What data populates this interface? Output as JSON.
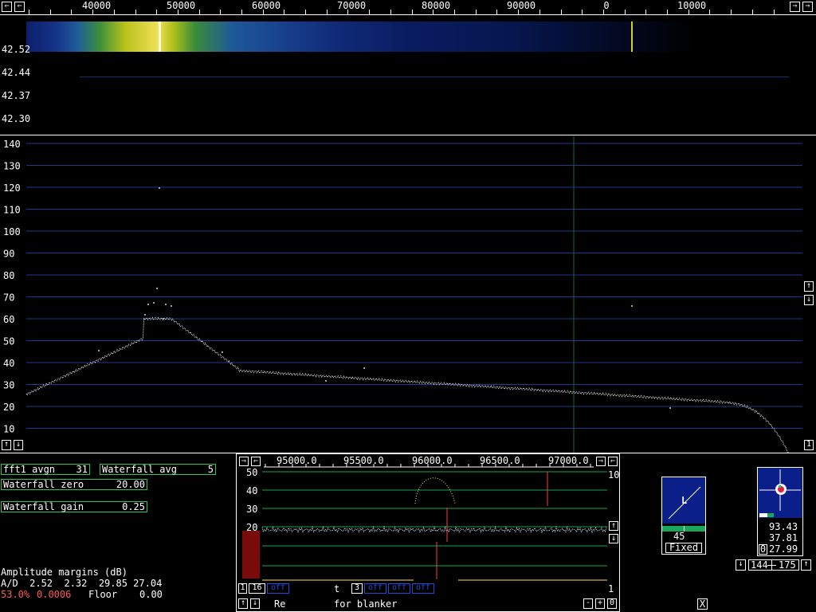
{
  "top_axis": {
    "labels": [
      "40000",
      "50000",
      "60000",
      "70000",
      "80000",
      "90000",
      "0",
      "10000"
    ],
    "left_arrow": "⇐",
    "right_arrow": "⇒",
    "right_arrow2": "⇐"
  },
  "waterfall": {
    "times": [
      "42.52",
      "42.44",
      "42.37",
      "42.30"
    ]
  },
  "spectrum": {
    "y_labels": [
      "140",
      "130",
      "120",
      "110",
      "100",
      "90",
      "80",
      "70",
      "60",
      "50",
      "40",
      "30",
      "20",
      "10"
    ],
    "marker_x_freq": 96900,
    "arrow_up": "↑",
    "arrow_down": "↓",
    "corner_one": "1"
  },
  "chart_data": [
    {
      "type": "scatter",
      "xlabel": "",
      "ylabel": "",
      "ylim": [
        0,
        145
      ],
      "xlim": [
        35000,
        15000
      ],
      "x_tick_labels": [
        "40000",
        "50000",
        "60000",
        "70000",
        "80000",
        "90000",
        "0",
        "10000"
      ],
      "y_tick_labels": [
        "140",
        "130",
        "120",
        "110",
        "100",
        "90",
        "80",
        "70",
        "60",
        "50",
        "40",
        "30",
        "20",
        "10"
      ],
      "series": [
        {
          "values_description_free": true,
          "points": [
            [
              35000,
              26
            ],
            [
              40000,
              32
            ],
            [
              43000,
              38
            ],
            [
              45000,
              55
            ],
            [
              46500,
              62
            ],
            [
              47500,
              60
            ],
            [
              49000,
              55
            ],
            [
              52000,
              40
            ],
            [
              56000,
              34
            ],
            [
              60000,
              30
            ],
            [
              65000,
              28
            ],
            [
              70000,
              26
            ],
            [
              75000,
              24
            ],
            [
              80000,
              22
            ],
            [
              85000,
              21
            ],
            [
              90000,
              20
            ],
            [
              95000,
              19
            ],
            [
              100000,
              18
            ],
            [
              104000,
              17
            ],
            [
              108000,
              14
            ],
            [
              112000,
              8
            ],
            [
              114000,
              0
            ]
          ]
        }
      ],
      "grid": true
    },
    {
      "type": "scatter",
      "title": "",
      "x_tick_labels": [
        "95000.0",
        "95500.0",
        "96000.0",
        "96500.0",
        "97000.0"
      ],
      "y_tick_labels": [
        "50",
        "40",
        "30",
        "20",
        "10",
        "0"
      ],
      "right_labels": [
        "10",
        "1"
      ],
      "grid": true
    }
  ],
  "controls": {
    "fft1_avgn_label": "fft1 avgn",
    "fft1_avgn_value": "31",
    "wf_avg_label": "Waterfall avg",
    "wf_avg_value": "5",
    "wf_zero_label": "Waterfall zero",
    "wf_zero_value": "20.00",
    "wf_gain_label": "Waterfall gain",
    "wf_gain_value": "0.25"
  },
  "amplitude": {
    "title": "Amplitude margins (dB)",
    "ad_line": "A/D  2.52  2.32  29.85 27.04",
    "pct": "53.0%",
    "val": "0.0006",
    "floor_label": "Floor",
    "floor_value": "0.00"
  },
  "bottom_panel": {
    "freq_labels": [
      "95000.0",
      "95500.0",
      "96000.0",
      "96500.0",
      "97000.0"
    ],
    "db_labels": [
      "50",
      "40",
      "30",
      "20",
      "10",
      "0"
    ],
    "right_top": "10",
    "right_bottom": "1",
    "row1": {
      "b1": "1",
      "b2": "16",
      "off1": "off",
      "t": "t",
      "three": "3",
      "off2": "off",
      "off3": "off",
      "off4": "off"
    },
    "row2": {
      "re": "Re",
      "for_blanker": "for blanker",
      "minus": "-",
      "plus": "+",
      "zero": "0"
    },
    "close": "X"
  },
  "meter_l": {
    "label": "L",
    "value": "45",
    "mode": "Fixed"
  },
  "meter_r": {
    "v1": "93.43",
    "v2": "37.81",
    "zero": "0",
    "v3": "27.99",
    "range_a": "144",
    "range_b": "175"
  }
}
